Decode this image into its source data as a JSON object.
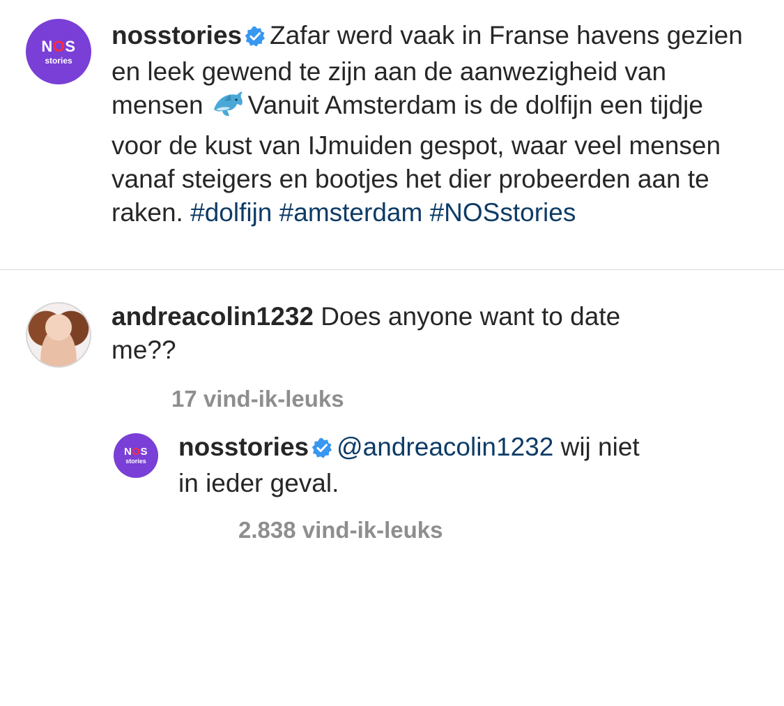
{
  "post": {
    "username": "nosstories",
    "avatar": {
      "top_text": "NOS",
      "bottom_text": "stories"
    },
    "caption_part1": "Zafar werd vaak in Franse havens gezien en leek gewend te zijn aan de aanwezigheid van mensen",
    "caption_emoji": "dolphin-icon",
    "caption_part2": "Vanuit Amsterdam is de dolfijn een tijdje voor de kust van IJmuiden gespot, waar veel mensen vanaf steigers en bootjes het dier probeerden aan te raken.",
    "hashtags": [
      "#dolfijn",
      "#amsterdam",
      "#NOSstories"
    ]
  },
  "comment": {
    "username": "andreacolin1232",
    "text": "Does anyone want to date me??",
    "likes": "17 vind-ik-leuks"
  },
  "reply": {
    "username": "nosstories",
    "avatar": {
      "top_text": "NOS",
      "bottom_text": "stories"
    },
    "mention": "@andreacolin1232",
    "text": "wij niet in ieder geval.",
    "likes": "2.838 vind-ik-leuks"
  },
  "colors": {
    "brand_purple": "#7a3fd6",
    "nos_red": "#ff2a3d",
    "verified_blue": "#3897f0",
    "hashtag_blue": "#0d3b66",
    "meta_gray": "#8e8e8e"
  }
}
